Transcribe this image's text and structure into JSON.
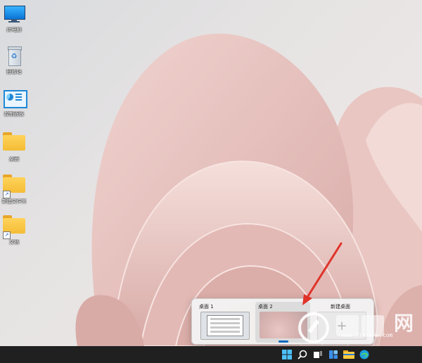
{
  "desktop": {
    "icons": [
      {
        "label": "此电脑",
        "icon": "monitor-icon"
      },
      {
        "label": "回收站",
        "icon": "recycle-bin-icon"
      },
      {
        "label": "控制面板",
        "icon": "control-panel-icon"
      },
      {
        "label": "桌面",
        "icon": "folder-icon"
      },
      {
        "label": "新建文件夹",
        "icon": "folder-shortcut-icon"
      },
      {
        "label": "文档",
        "icon": "folder-shortcut-icon"
      }
    ]
  },
  "virtual_desktops": {
    "desktops": [
      {
        "label": "桌面 1"
      },
      {
        "label": "桌面 2"
      }
    ],
    "new_label": "新建桌面",
    "new_icon": "+"
  },
  "taskbar": {
    "items": [
      "start-icon",
      "search-icon",
      "task-view-icon",
      "widgets-icon",
      "file-explorer-icon",
      "edge-icon"
    ]
  },
  "watermark": {
    "text": "网",
    "url": "www.jixianw.com"
  },
  "colors": {
    "accent": "#0067c0",
    "arrow": "#e0332a",
    "taskbar": "#202020"
  }
}
